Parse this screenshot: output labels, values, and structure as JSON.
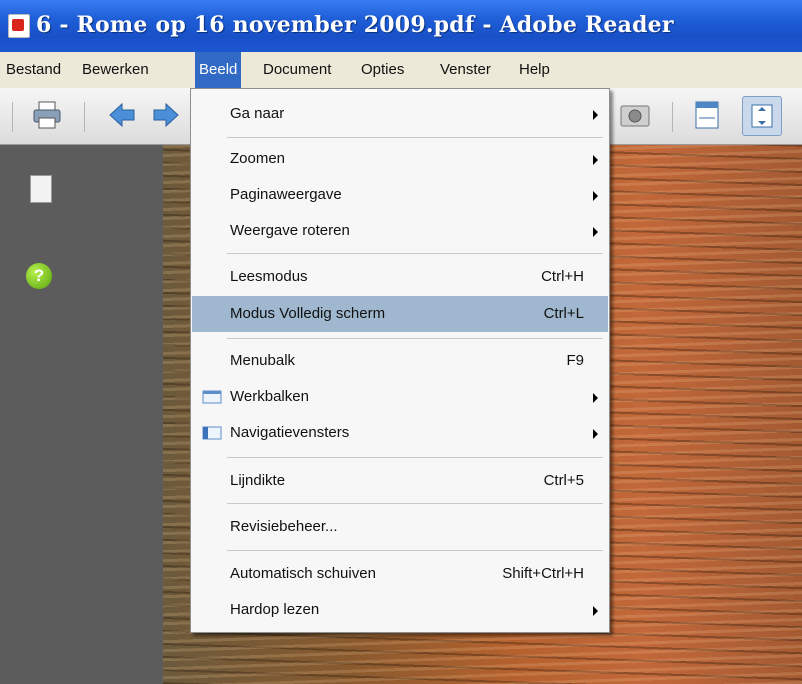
{
  "window": {
    "title": "6 - Rome op 16 november 2009.pdf - Adobe Reader"
  },
  "menubar": [
    {
      "label": "Bestand"
    },
    {
      "label": "Bewerken"
    },
    {
      "label": "Beeld"
    },
    {
      "label": "Document"
    },
    {
      "label": "Opties"
    },
    {
      "label": "Venster"
    },
    {
      "label": "Help"
    }
  ],
  "dropdown": {
    "items": [
      {
        "label": "Ga naar",
        "shortcut": "",
        "submenu": true,
        "icon": ""
      },
      {
        "label": "Zoomen",
        "shortcut": "",
        "submenu": true,
        "icon": ""
      },
      {
        "label": "Paginaweergave",
        "shortcut": "",
        "submenu": true,
        "icon": ""
      },
      {
        "label": "Weergave roteren",
        "shortcut": "",
        "submenu": true,
        "icon": ""
      },
      {
        "label": "Leesmodus",
        "shortcut": "Ctrl+H",
        "submenu": false,
        "icon": ""
      },
      {
        "label": "Modus Volledig scherm",
        "shortcut": "Ctrl+L",
        "submenu": false,
        "icon": "",
        "highlighted": true
      },
      {
        "label": "Menubalk",
        "shortcut": "F9",
        "submenu": false,
        "icon": ""
      },
      {
        "label": "Werkbalken",
        "shortcut": "",
        "submenu": true,
        "icon": "toolbars-icon"
      },
      {
        "label": "Navigatievensters",
        "shortcut": "",
        "submenu": true,
        "icon": "navigation-panes-icon"
      },
      {
        "label": "Lijndikte",
        "shortcut": "Ctrl+5",
        "submenu": false,
        "icon": ""
      },
      {
        "label": "Revisiebeheer...",
        "shortcut": "",
        "submenu": false,
        "icon": ""
      },
      {
        "label": "Automatisch schuiven",
        "shortcut": "Shift+Ctrl+H",
        "submenu": false,
        "icon": ""
      },
      {
        "label": "Hardop lezen",
        "shortcut": "",
        "submenu": true,
        "icon": ""
      }
    ]
  },
  "toolbar": {
    "buttons": [
      {
        "icon": "print-icon"
      },
      {
        "icon": "previous-page-icon"
      },
      {
        "icon": "next-page-icon"
      },
      {
        "icon": "snapshot-icon"
      },
      {
        "icon": "fit-width-icon"
      },
      {
        "icon": "fit-page-icon"
      }
    ]
  },
  "navpane": {
    "help_label": "?"
  },
  "colors": {
    "titlebar": "#1f5fd8",
    "menu_highlight": "#316ac5",
    "item_highlight": "#9fb8cf"
  }
}
